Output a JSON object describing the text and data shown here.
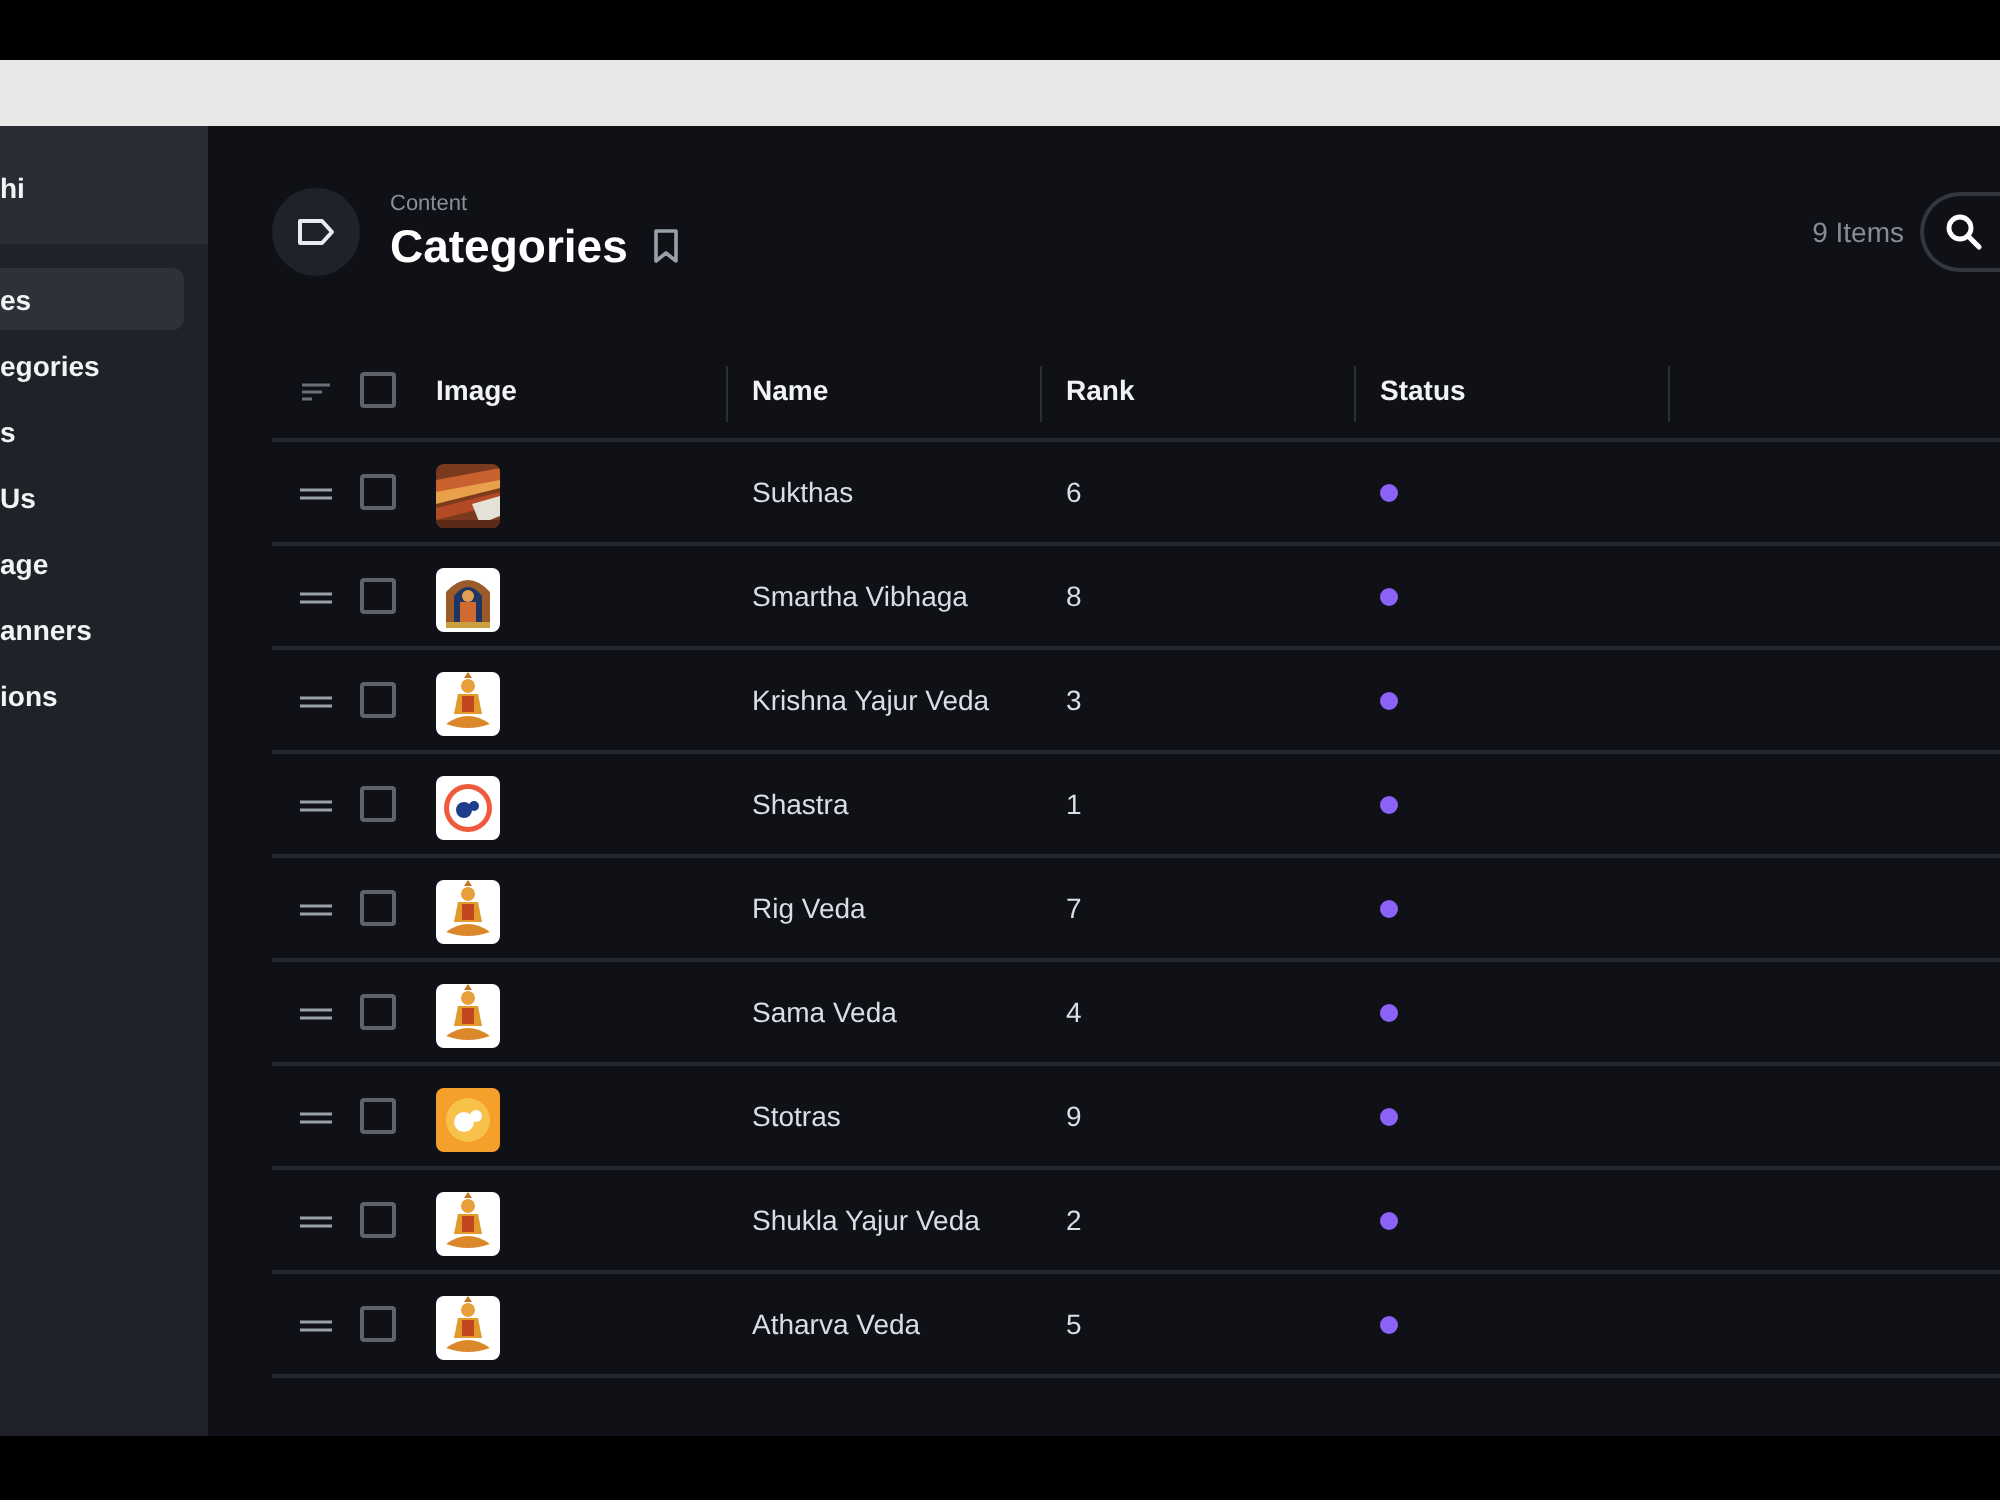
{
  "sidebar": {
    "header": "hi",
    "items": [
      {
        "label": "es",
        "selected": true
      },
      {
        "label": "egories",
        "selected": false
      },
      {
        "label": "s",
        "selected": false
      },
      {
        "label": "Us",
        "selected": false
      },
      {
        "label": "age",
        "selected": false
      },
      {
        "label": "anners",
        "selected": false
      },
      {
        "label": "ions",
        "selected": false
      }
    ]
  },
  "header": {
    "breadcrumb": "Content",
    "title": "Categories",
    "count": "9 Items"
  },
  "table": {
    "columns": [
      "Image",
      "Name",
      "Rank",
      "Status"
    ],
    "all_checked": false,
    "rows": [
      {
        "name": "Sukthas",
        "rank": "6",
        "checked": false
      },
      {
        "name": "Smartha Vibhaga",
        "rank": "8",
        "checked": false
      },
      {
        "name": "Krishna Yajur Veda",
        "rank": "3",
        "checked": false
      },
      {
        "name": "Shastra",
        "rank": "1",
        "checked": false
      },
      {
        "name": "Rig Veda",
        "rank": "7",
        "checked": false
      },
      {
        "name": "Sama Veda",
        "rank": "4",
        "checked": false
      },
      {
        "name": "Stotras",
        "rank": "9",
        "checked": false
      },
      {
        "name": "Shukla Yajur Veda",
        "rank": "2",
        "checked": false
      },
      {
        "name": "Atharva Veda",
        "rank": "5",
        "checked": false
      }
    ]
  }
}
